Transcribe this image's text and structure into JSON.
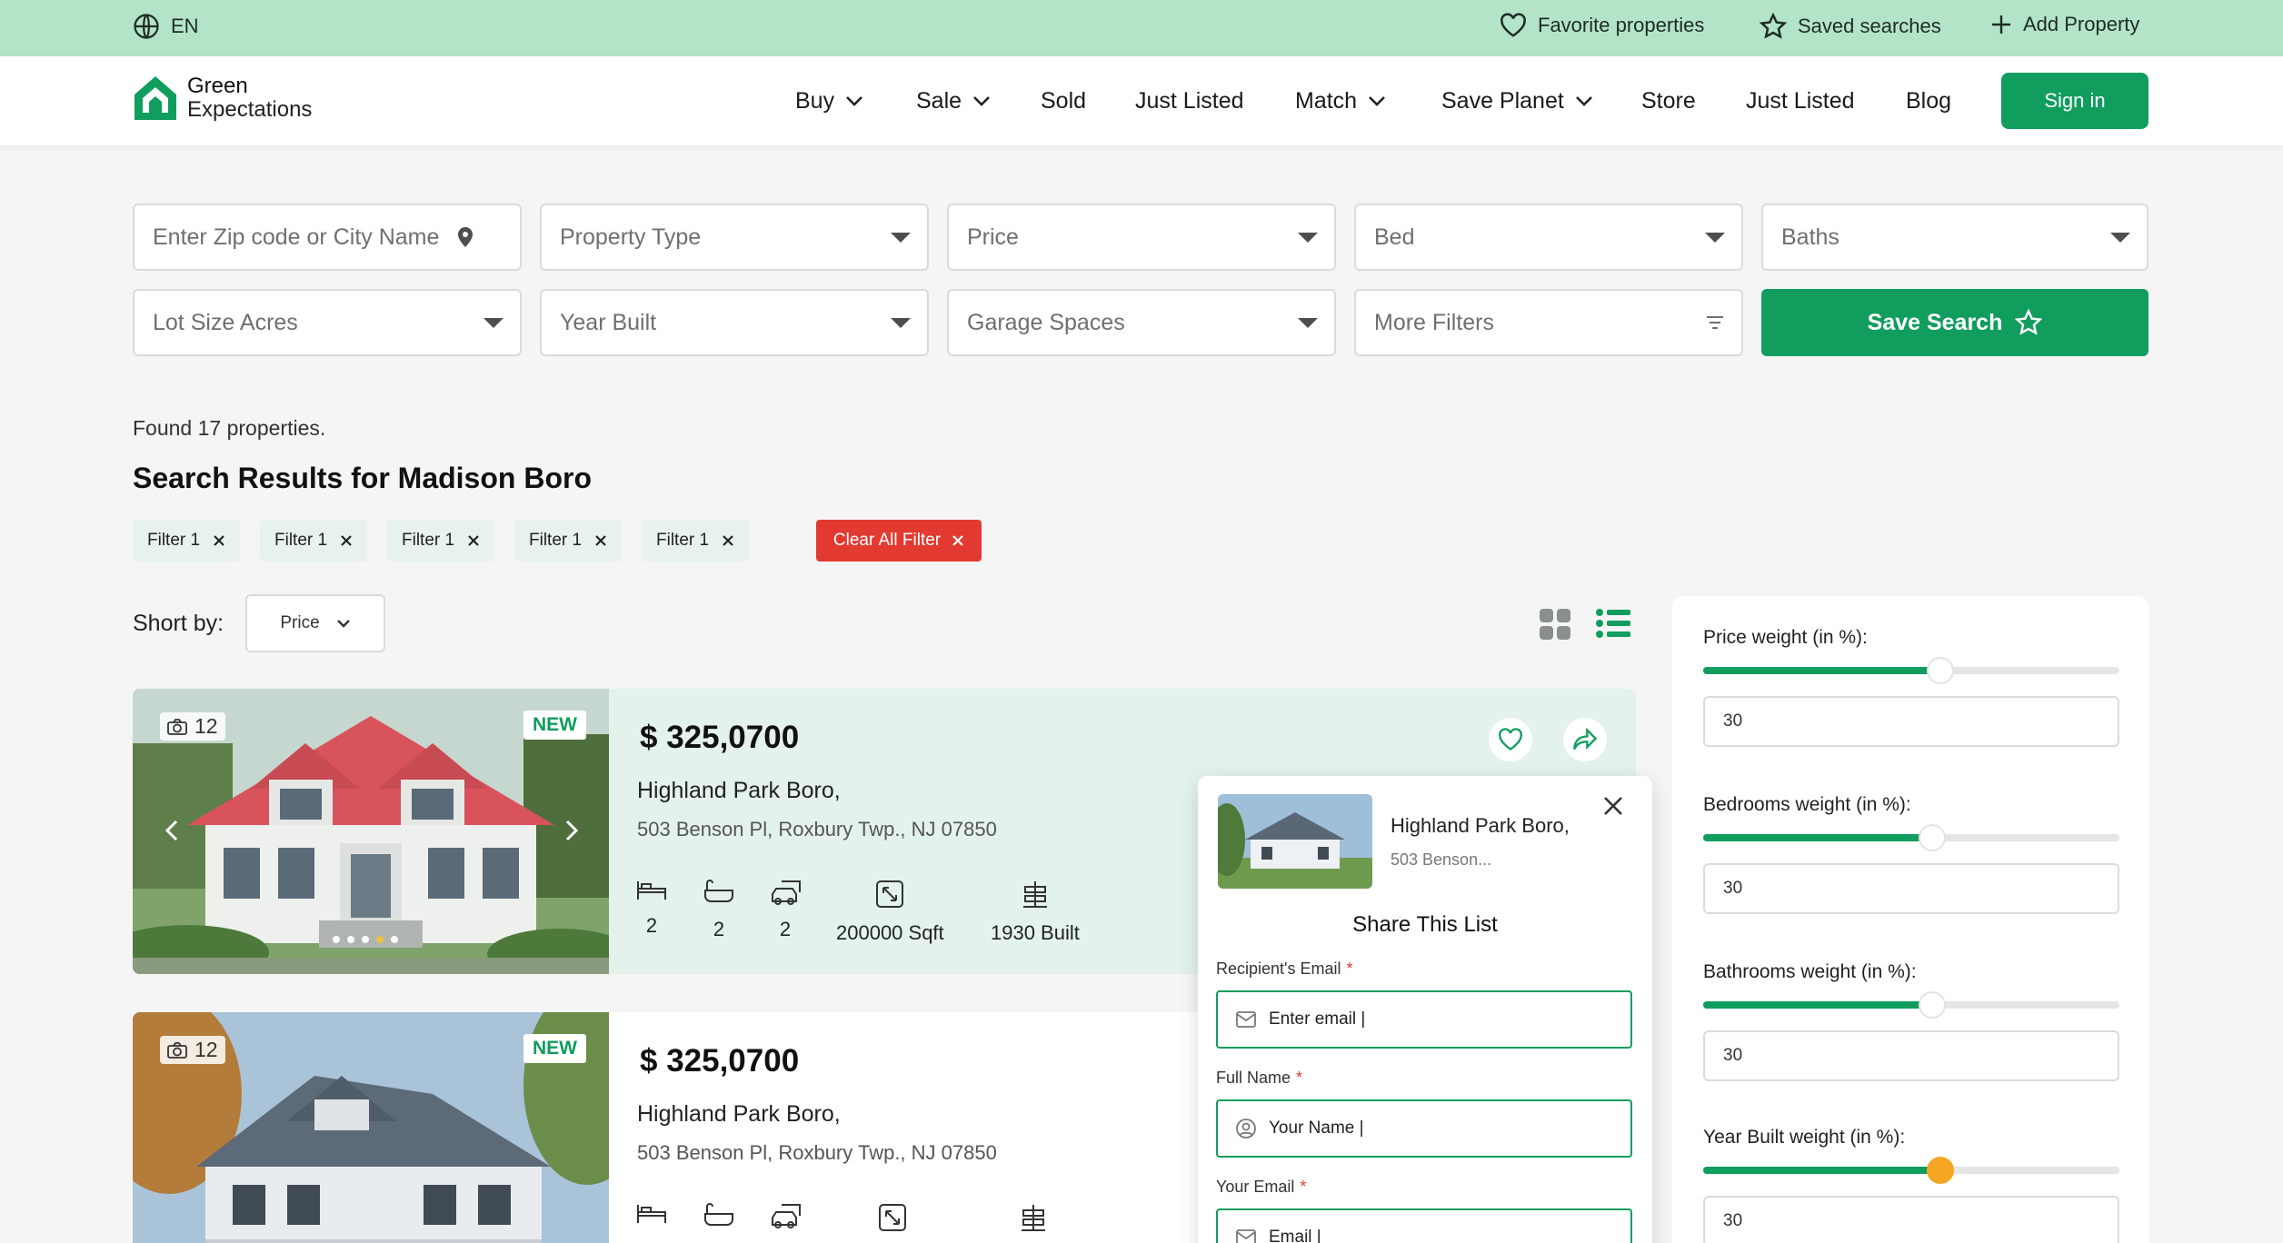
{
  "topbar": {
    "language": "EN",
    "favorites": "Favorite properties",
    "saved_searches": "Saved searches",
    "add_property": "Add Property"
  },
  "brand": {
    "line1": "Green",
    "line2": "Expectations"
  },
  "nav": {
    "items": [
      "Buy",
      "Sale",
      "Sold",
      "Just Listed",
      "Match",
      "Save Planet",
      "Store",
      "Just Listed",
      "Blog"
    ],
    "sign_in": "Sign in"
  },
  "filters": {
    "location_placeholder": "Enter Zip code or City Name",
    "property_type": "Property Type",
    "price": "Price",
    "bed": "Bed",
    "baths": "Baths",
    "lot_size": "Lot Size Acres",
    "year_built": "Year Built",
    "garage": "Garage Spaces",
    "more_filters": "More Filters",
    "save_search": "Save Search"
  },
  "results": {
    "found": "Found 17 properties.",
    "title": "Search Results for Madison Boro",
    "chips": [
      "Filter 1",
      "Filter 1",
      "Filter 1",
      "Filter 1",
      "Filter 1"
    ],
    "clear_all": "Clear All Filter",
    "sort_label": "Short by:",
    "sort_value": "Price"
  },
  "listings": [
    {
      "photo_count": "12",
      "tag": "NEW",
      "price": "$ 325,0700",
      "title": "Highland Park Boro,",
      "address": "503 Benson Pl, Roxbury Twp., NJ 07850",
      "beds": "2",
      "baths": "2",
      "garage": "2",
      "sqft": "200000 Sqft",
      "built": "1930 Built"
    },
    {
      "photo_count": "12",
      "tag": "NEW",
      "price": "$ 325,0700",
      "title": "Highland Park Boro,",
      "address": "503 Benson Pl, Roxbury Twp., NJ 07850"
    }
  ],
  "share": {
    "title": "Highland Park Boro,",
    "subtitle": "503 Benson...",
    "heading": "Share This List",
    "recipient_label": "Recipient's Email",
    "recipient_value": "Enter email |",
    "name_label": "Full Name",
    "name_value": "Your Name |",
    "email_label": "Your Email",
    "email_value": "Email |",
    "required_mark": "*"
  },
  "weights": [
    {
      "label": "Price weight (in %):",
      "value": "30",
      "level": 0.57
    },
    {
      "label": "Bedrooms weight (in %):",
      "value": "30",
      "level": 0.55
    },
    {
      "label": "Bathrooms weight (in %):",
      "value": "30",
      "level": 0.55
    },
    {
      "label": "Year Built weight (in %):",
      "value": "30",
      "level": 0.57
    }
  ],
  "colors": {
    "brand": "#109d5e",
    "topbar": "#b3e4c8",
    "danger": "#e23a31",
    "accent_knob": "#f5a623"
  }
}
